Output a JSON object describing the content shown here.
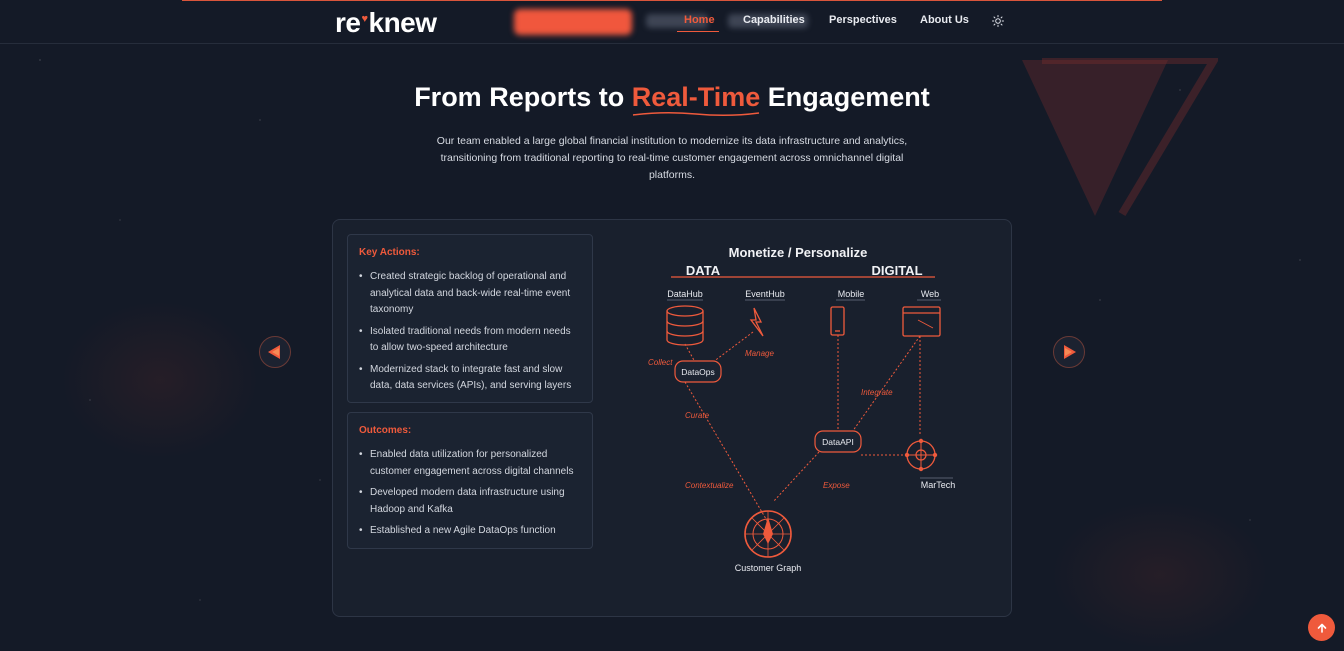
{
  "nav": {
    "logo_prefix": "re",
    "logo_suffix": "knew",
    "cta_label": "",
    "items": [
      {
        "label": "Home",
        "active": true
      },
      {
        "label": "Capabilities",
        "active": false
      },
      {
        "label": "Perspectives",
        "active": false
      },
      {
        "label": "About Us",
        "active": false
      }
    ],
    "theme_icon": "sun-icon"
  },
  "hero": {
    "title_before": "From Reports to ",
    "title_accent": "Real-Time",
    "title_after": " Engagement",
    "subtitle": "Our team enabled a large global financial institution to modernize its data infrastructure and analytics, transitioning from traditional reporting to real-time customer engagement across omnichannel digital platforms."
  },
  "key_actions": {
    "heading": "Key Actions:",
    "items": [
      "Created strategic backlog of operational and analytical data and back-wide real-time event taxonomy",
      "Isolated traditional needs from modern needs to allow two-speed architecture",
      "Modernized stack to integrate fast and slow data, data services (APIs), and serving layers"
    ]
  },
  "outcomes": {
    "heading": "Outcomes:",
    "items": [
      "Enabled data utilization for personalized customer engagement across digital channels",
      "Developed modern data infrastructure using Hadoop and Kafka",
      "Established a new Agile DataOps function"
    ]
  },
  "diagram": {
    "title": "Monetize / Personalize",
    "left_heading": "DATA",
    "right_heading": "DIGITAL",
    "nodes": {
      "datahub": "DataHub",
      "eventhub": "EventHub",
      "mobile": "Mobile",
      "web": "Web",
      "dataops": "DataOps",
      "dataapi": "DataAPI",
      "martech": "MarTech",
      "customer_graph": "Customer Graph"
    },
    "edges": {
      "collect": "Collect",
      "manage": "Manage",
      "curate": "Curate",
      "integrate": "Integrate",
      "contextualize": "Contextualize",
      "expose": "Expose"
    }
  },
  "colors": {
    "accent": "#ef5a3c",
    "background": "#141a27",
    "card": "#19202d"
  }
}
